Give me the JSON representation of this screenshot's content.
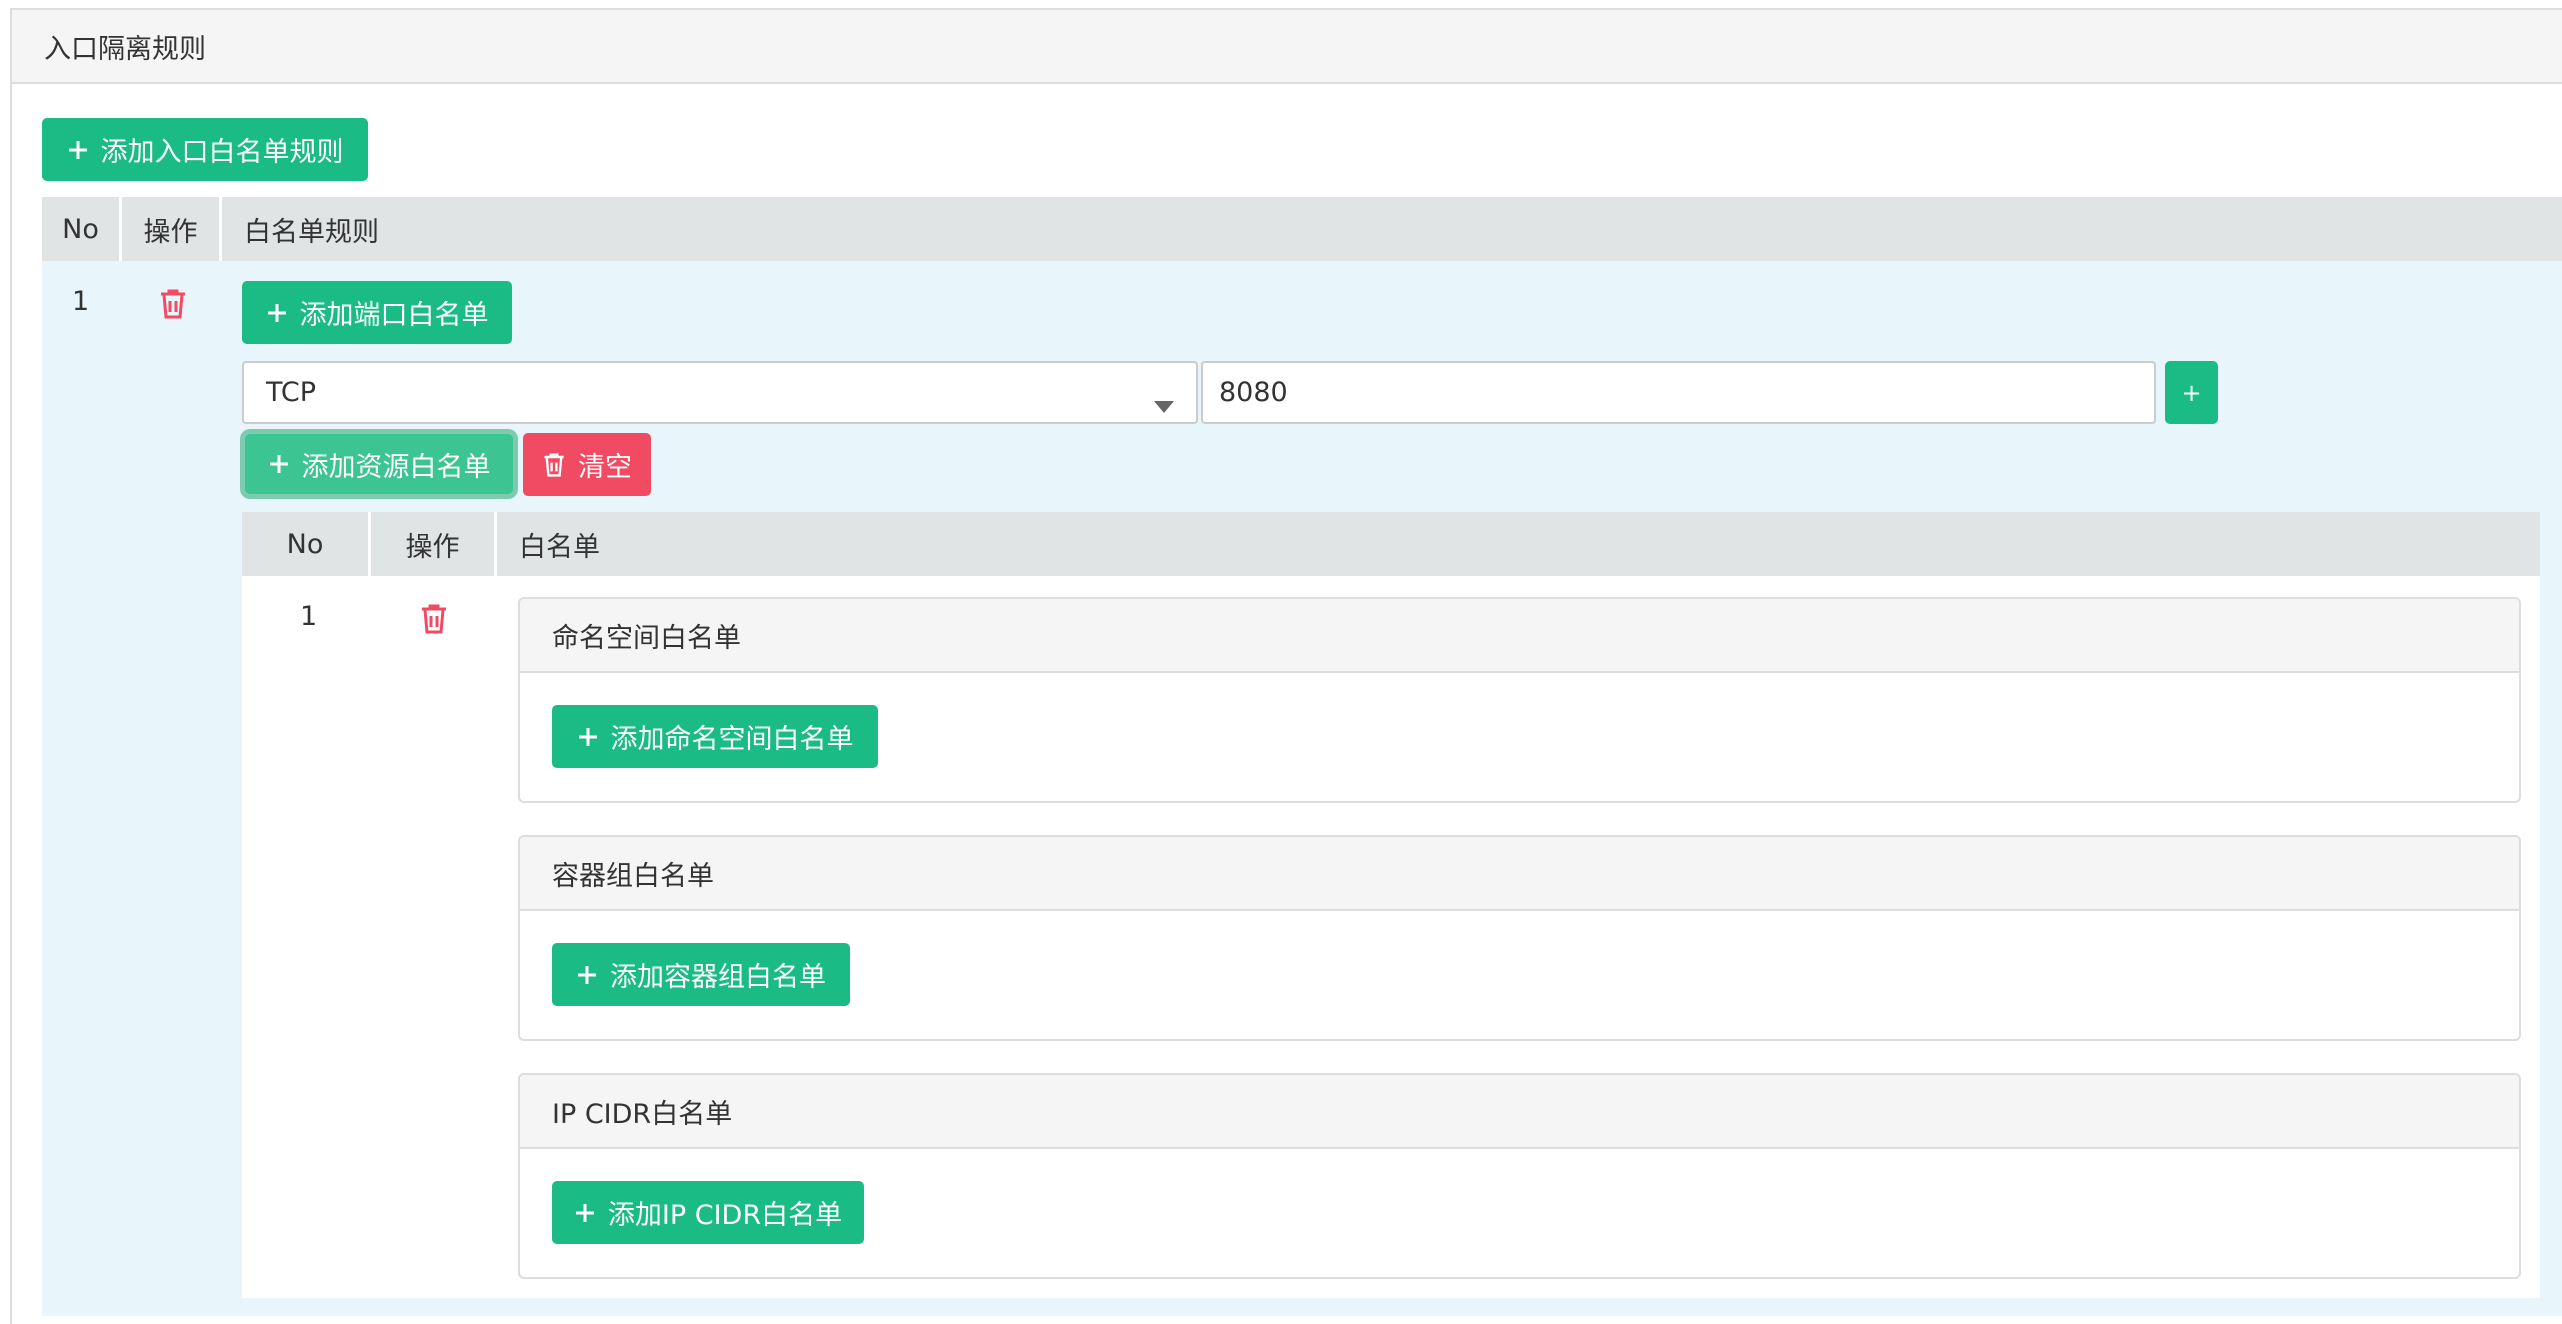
{
  "panel": {
    "title": "入口隔离规则",
    "add_rule_button": "添加入口白名单规则"
  },
  "outer_table": {
    "headers": {
      "no": "No",
      "action": "操作",
      "rule": "白名单规则"
    },
    "row": {
      "no": "1",
      "add_port_button": "添加端口白名单",
      "protocol": {
        "selected": "TCP"
      },
      "port_value": "8080",
      "add_port_row_button": "+",
      "add_resource_button": "添加资源白名单",
      "clear_button": "清空"
    }
  },
  "inner_table": {
    "headers": {
      "no": "No",
      "action": "操作",
      "whitelist": "白名单"
    },
    "row": {
      "no": "1"
    }
  },
  "sections": {
    "namespace": {
      "title": "命名空间白名单",
      "button": "添加命名空间白名单"
    },
    "pod_group": {
      "title": "容器组白名单",
      "button": "添加容器组白名单"
    },
    "ip_cidr": {
      "title": "IP CIDR白名单",
      "button": "添加IP CIDR白名单"
    }
  },
  "colors": {
    "success": "#1abb85",
    "danger": "#f14b64",
    "row_bg": "#e8f5fa",
    "header_bg": "#e1e4e5"
  },
  "icons": {
    "plus": "plus-icon",
    "trash": "trash-icon",
    "caret": "caret-down-icon"
  }
}
